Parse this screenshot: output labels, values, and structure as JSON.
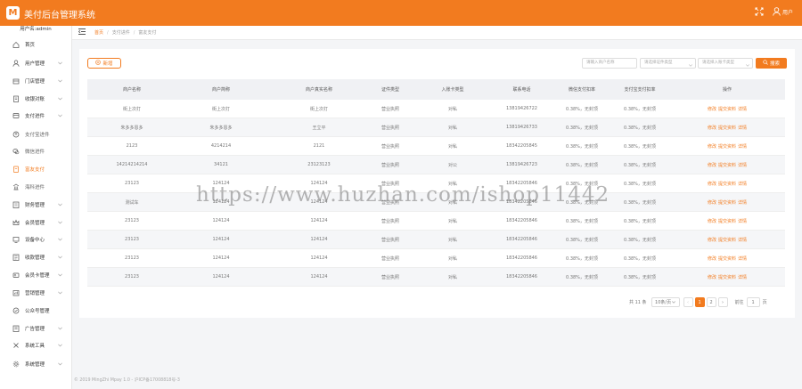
{
  "header": {
    "logo_text": "M",
    "app_title": "美付后台管理系统",
    "user_label": "用户"
  },
  "sidebar": {
    "user": "用户名:admin",
    "items": [
      {
        "label": "首页",
        "icon": "home-icon",
        "chev": false,
        "sub": false,
        "active": false
      },
      {
        "label": "用户管理",
        "icon": "user-icon",
        "chev": true,
        "sub": false,
        "active": false
      },
      {
        "label": "门店管理",
        "icon": "store-icon",
        "chev": true,
        "sub": false,
        "active": false
      },
      {
        "label": "收银对账",
        "icon": "ledger-icon",
        "chev": true,
        "sub": false,
        "active": false
      },
      {
        "label": "支付进件",
        "icon": "card-icon",
        "chev": true,
        "sub": false,
        "active": false
      },
      {
        "label": "支付宝进件",
        "icon": "alipay-icon",
        "chev": false,
        "sub": true,
        "active": false
      },
      {
        "label": "微信进件",
        "icon": "wechat-icon",
        "chev": false,
        "sub": true,
        "active": false
      },
      {
        "label": "富友支付",
        "icon": "pay-icon",
        "chev": false,
        "sub": true,
        "active": true
      },
      {
        "label": "海科进件",
        "icon": "bank-icon",
        "chev": false,
        "sub": true,
        "active": false
      },
      {
        "label": "财务管理",
        "icon": "finance-icon",
        "chev": true,
        "sub": false,
        "active": false
      },
      {
        "label": "会员管理",
        "icon": "crown-icon",
        "chev": true,
        "sub": false,
        "active": false
      },
      {
        "label": "设备中心",
        "icon": "device-icon",
        "chev": true,
        "sub": false,
        "active": false
      },
      {
        "label": "收款管理",
        "icon": "receipt-icon",
        "chev": true,
        "sub": false,
        "active": false
      },
      {
        "label": "会员卡管理",
        "icon": "member-card-icon",
        "chev": true,
        "sub": false,
        "active": false
      },
      {
        "label": "营销管理",
        "icon": "marketing-icon",
        "chev": true,
        "sub": false,
        "active": false
      },
      {
        "label": "公众号管理",
        "icon": "official-account-icon",
        "chev": false,
        "sub": false,
        "active": false
      },
      {
        "label": "广告管理",
        "icon": "ad-icon",
        "chev": true,
        "sub": false,
        "active": false
      },
      {
        "label": "系统工具",
        "icon": "tools-icon",
        "chev": true,
        "sub": false,
        "active": false
      },
      {
        "label": "系统管理",
        "icon": "gear-icon",
        "chev": true,
        "sub": false,
        "active": false
      }
    ]
  },
  "breadcrumb": [
    "首页",
    "支付进件",
    "富友支付"
  ],
  "toolbar": {
    "add_label": "新增",
    "filters": [
      "请输入商户名称",
      "请选择证件类型",
      "请选择入账卡类型"
    ],
    "search_label": "搜索"
  },
  "table": {
    "headers": [
      "商户名称",
      "商户简称",
      "商户真实名称",
      "证件类型",
      "入账卡类型",
      "联系电话",
      "微信支付扣率",
      "支付宝支付扣率",
      "操作"
    ],
    "rows": [
      [
        "街上次打",
        "街上次打",
        "街上次打",
        "营业执照",
        "对私",
        "13819426722",
        "0.38%，无封顶",
        "0.38%，无封顶"
      ],
      [
        "朱多多恩多",
        "朱多多恩多",
        "王立平",
        "营业执照",
        "对私",
        "13819426733",
        "0.38%，无封顶",
        "0.38%，无封顶"
      ],
      [
        "2123",
        "4214214",
        "2121",
        "营业执照",
        "对私",
        "18342205845",
        "0.38%，无封顶",
        "0.38%，无封顶"
      ],
      [
        "14214214214",
        "34121",
        "23123123",
        "营业执照",
        "对公",
        "13819426723",
        "0.38%，无封顶",
        "0.38%，无封顶"
      ],
      [
        "23123",
        "124124",
        "124124",
        "营业执照",
        "对私",
        "18342205846",
        "0.38%，无封顶",
        "0.38%，无封顶"
      ],
      [
        "测试车",
        "124124",
        "124124",
        "营业执照",
        "对私",
        "18342205846",
        "0.38%，无封顶",
        "0.38%，无封顶"
      ],
      [
        "23123",
        "124124",
        "124124",
        "营业执照",
        "对私",
        "18342205846",
        "0.38%，无封顶",
        "0.38%，无封顶"
      ],
      [
        "23123",
        "124124",
        "124124",
        "营业执照",
        "对私",
        "18342205846",
        "0.38%，无封顶",
        "0.38%，无封顶"
      ],
      [
        "23123",
        "124124",
        "124124",
        "营业执照",
        "对私",
        "18342205846",
        "0.38%，无封顶",
        "0.38%，无封顶"
      ],
      [
        "23123",
        "124124",
        "124124",
        "营业执照",
        "对私",
        "18342205846",
        "0.38%，无封顶",
        "0.38%，无封顶"
      ]
    ],
    "row_ops": [
      [
        "修改",
        "提交资料",
        "详情"
      ],
      [
        "修改",
        "提交资料",
        "详情"
      ],
      [
        "修改",
        "提交资料",
        "详情"
      ],
      [
        "修改",
        "提交资料",
        "详情"
      ],
      [
        "修改",
        "提交资料",
        "详情"
      ],
      [
        "修改",
        "提交资料",
        "详情"
      ],
      [
        "修改",
        "提交资料",
        "详情"
      ],
      [
        "修改",
        "提交资料",
        "详情"
      ],
      [
        "修改",
        "提交资料",
        "详情"
      ],
      [
        "修改",
        "提交资料",
        "详情"
      ]
    ]
  },
  "pagination": {
    "total": "共 11 条",
    "page_size": "10条/页",
    "pages": [
      "1",
      "2"
    ],
    "current": "1",
    "goto_label": "前往",
    "goto_value": "1",
    "page_unit": "页"
  },
  "footer": "© 2019 MingZhi Mpay 1.0 - 沪ICP备17008818号-3",
  "watermark": "https://www.huzhan.com/ishop11442",
  "colors": {
    "accent": "#f27b1f",
    "header_bg": "#f0f1f4"
  }
}
